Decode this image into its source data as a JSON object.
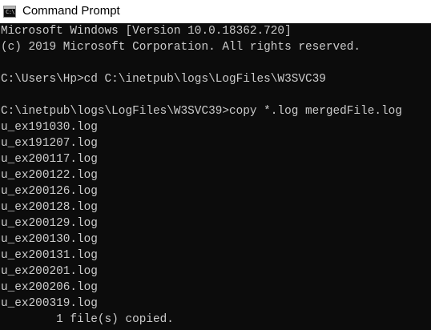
{
  "window": {
    "title": "Command Prompt",
    "icon": "cmd-icon",
    "icon_glyph": "C:\\"
  },
  "console": {
    "lines": [
      "Microsoft Windows [Version 10.0.18362.720]",
      "(c) 2019 Microsoft Corporation. All rights reserved.",
      "",
      "C:\\Users\\Hp>cd C:\\inetpub\\logs\\LogFiles\\W3SVC39",
      "",
      "C:\\inetpub\\logs\\LogFiles\\W3SVC39>copy *.log mergedFile.log",
      "u_ex191030.log",
      "u_ex191207.log",
      "u_ex200117.log",
      "u_ex200122.log",
      "u_ex200126.log",
      "u_ex200128.log",
      "u_ex200129.log",
      "u_ex200130.log",
      "u_ex200131.log",
      "u_ex200201.log",
      "u_ex200206.log",
      "u_ex200319.log",
      "        1 file(s) copied."
    ]
  },
  "colors": {
    "console_bg": "#0c0c0c",
    "console_text": "#cccccc",
    "titlebar_bg": "#ffffff"
  }
}
